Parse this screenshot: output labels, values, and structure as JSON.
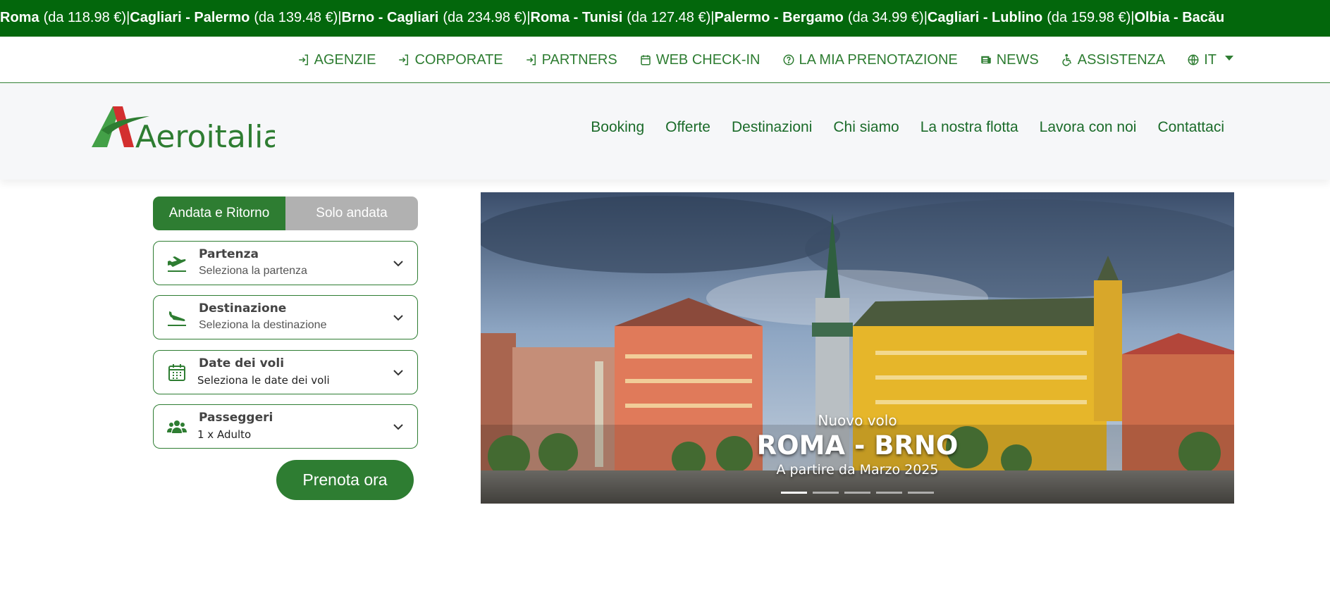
{
  "ticker": [
    {
      "route": "Roma",
      "price": "(da 118.98 €)"
    },
    {
      "route": "Cagliari - Palermo",
      "price": "(da 139.48 €)"
    },
    {
      "route": "Brno - Cagliari",
      "price": "(da 234.98 €)"
    },
    {
      "route": "Roma - Tunisi",
      "price": "(da 127.48 €)"
    },
    {
      "route": "Palermo - Bergamo",
      "price": "(da 34.99 €)"
    },
    {
      "route": "Cagliari - Lublino",
      "price": "(da 159.98 €)"
    },
    {
      "route": "Olbia - Bacău",
      "price": ""
    }
  ],
  "ticker_separator": "|",
  "topnav": {
    "agenzie": "AGENZIE",
    "corporate": "CORPORATE",
    "partners": "PARTNERS",
    "checkin": "WEB CHECK-IN",
    "booking": "LA MIA PRENOTAZIONE",
    "news": "NEWS",
    "assistenza": "ASSISTENZA",
    "lang": "IT"
  },
  "brand": {
    "name": "Aeroitalia",
    "green": "#2e7d32",
    "red": "#d32f2f"
  },
  "mainnav": {
    "booking": "Booking",
    "offerte": "Offerte",
    "destinazioni": "Destinazioni",
    "chi_siamo": "Chi siamo",
    "flotta": "La nostra flotta",
    "lavora": "Lavora con noi",
    "contattaci": "Contattaci"
  },
  "form": {
    "trip_round": "Andata e Ritorno",
    "trip_oneway": "Solo andata",
    "departure": {
      "label": "Partenza",
      "value": "Seleziona la partenza",
      "icon": "plane-takeoff-icon"
    },
    "destination": {
      "label": "Destinazione",
      "value": "Seleziona la destinazione",
      "icon": "plane-landing-icon"
    },
    "dates": {
      "label": "Date dei voli",
      "value": "Seleziona le date dei voli",
      "icon": "calendar-icon"
    },
    "passengers": {
      "label": "Passeggeri",
      "value": "1 x Adulto",
      "icon": "users-icon"
    },
    "submit": "Prenota ora"
  },
  "hero": {
    "subtitle": "Nuovo volo",
    "title": "ROMA - BRNO",
    "date": "A partire da Marzo 2025",
    "slides_total": 5,
    "slide_active": 1
  }
}
